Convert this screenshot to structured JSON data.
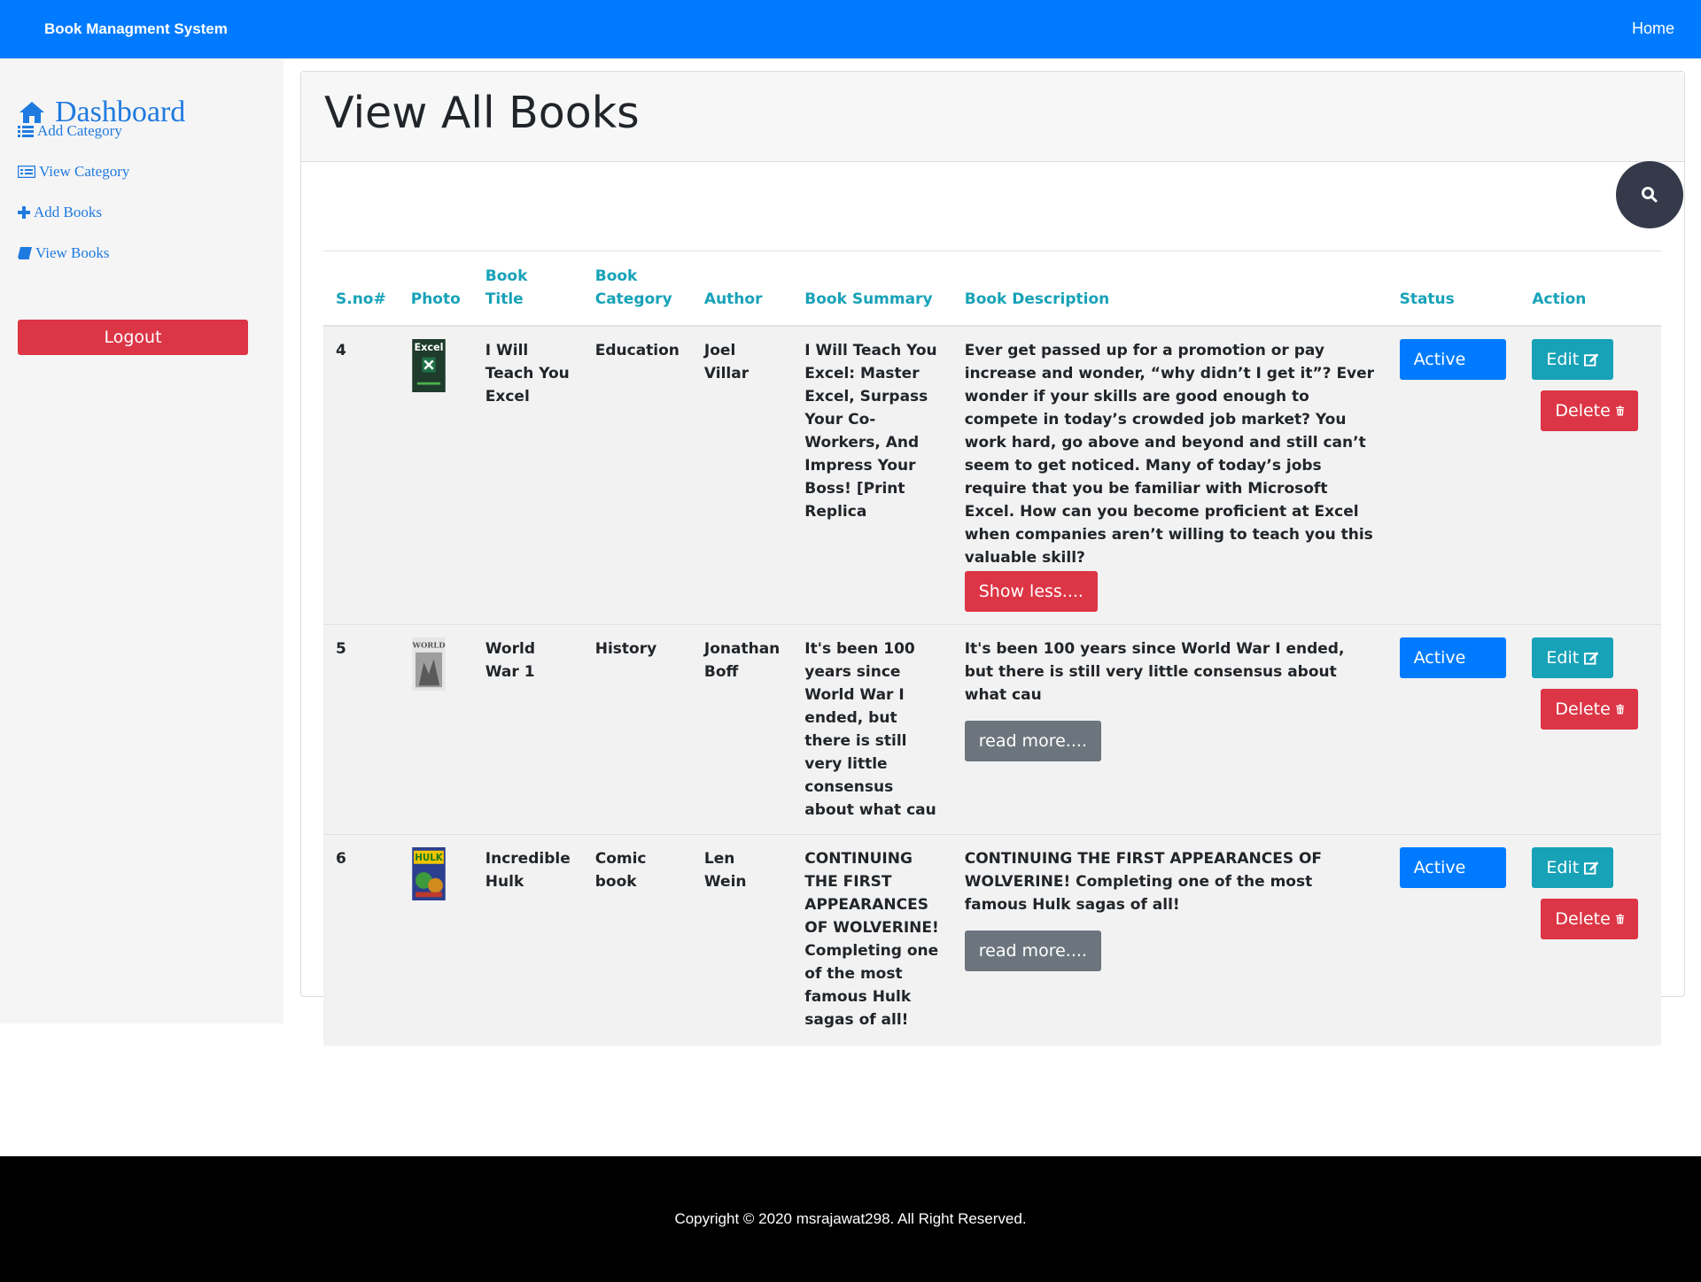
{
  "navbar": {
    "brand": "Book Managment System",
    "home": "Home"
  },
  "sidebar": {
    "dashboard": "Dashboard",
    "items": [
      {
        "label": "Add Category",
        "icon": "list-icon"
      },
      {
        "label": "View Category",
        "icon": "card-list-icon"
      },
      {
        "label": "Add Books",
        "icon": "plus-icon"
      },
      {
        "label": "View Books",
        "icon": "book-icon"
      }
    ],
    "logout": "Logout"
  },
  "main": {
    "title": "View All Books",
    "search_icon": "search-icon",
    "table": {
      "headers": [
        "S.no#",
        "Photo",
        "Book Title",
        "Book Category",
        "Author",
        "Book Summary",
        "Book Description",
        "Status",
        "Action"
      ],
      "rows": [
        {
          "sno": "4",
          "photo": "Excel",
          "title": "I Will Teach You Excel",
          "category": "Education",
          "author": "Joel Villar",
          "summary": "I Will Teach You Excel: Master Excel, Surpass Your Co-Workers, And Impress Your Boss! [Print Replica",
          "description": "Ever get passed up for a promotion or pay increase and wonder, “why didn’t I get it”? Ever wonder if your skills are good enough to compete in today’s crowded job market? You work hard, go above and beyond and still can’t seem to get noticed. Many of today’s jobs require that you be familiar with Microsoft Excel. How can you become proficient at Excel when companies aren’t willing to teach you this valuable skill?",
          "toggle": "Show less....",
          "status": "Active",
          "edit": "Edit",
          "delete": "Delete"
        },
        {
          "sno": "5",
          "photo": "WORLD",
          "title": "World War 1",
          "category": "History",
          "author": "Jonathan Boff",
          "summary": "It's been 100 years since World War I ended, but there is still very little consensus about what cau",
          "description": "It's been 100 years since World War I ended, but there is still very little consensus about what cau",
          "toggle": "read more....",
          "status": "Active",
          "edit": "Edit",
          "delete": "Delete"
        },
        {
          "sno": "6",
          "photo": "HULK",
          "title": "Incredible Hulk",
          "category": "Comic book",
          "author": "Len Wein",
          "summary": "CONTINUING THE FIRST APPEARANCES OF WOLVERINE! Completing one of the most famous Hulk sagas of all!",
          "description": "CONTINUING THE FIRST APPEARANCES OF WOLVERINE! Completing one of the most famous Hulk sagas of all!",
          "toggle": "read more....",
          "status": "Active",
          "edit": "Edit",
          "delete": "Delete"
        }
      ]
    }
  },
  "footer": {
    "copyright": "Copyright © 2020 msrajawat298. All Right Reserved."
  }
}
